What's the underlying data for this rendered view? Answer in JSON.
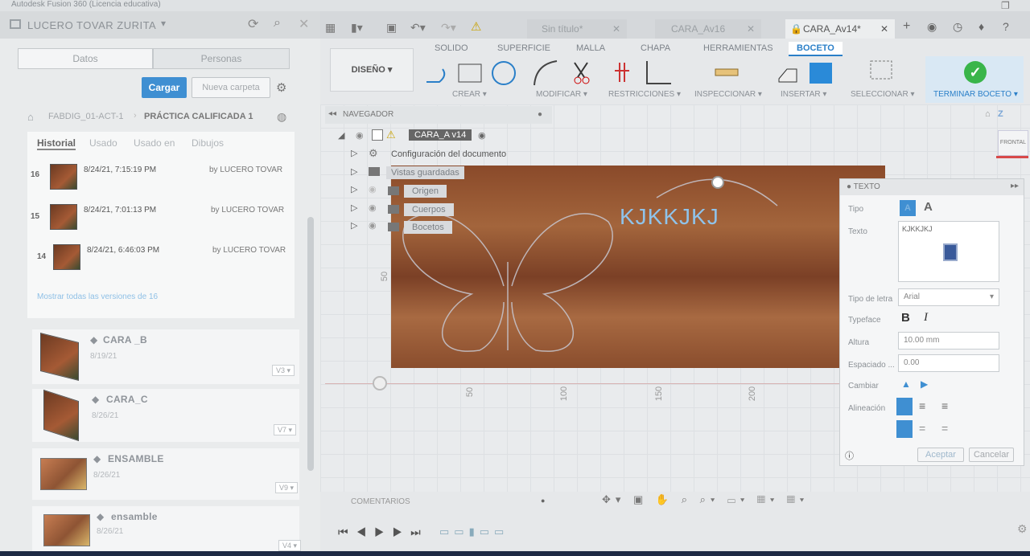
{
  "window_title": "Autodesk Fusion 360 (Licencia educativa)",
  "user_name": "LUCERO TOVAR ZURITA",
  "data_tabs": [
    "Datos",
    "Personas"
  ],
  "upload_label": "Cargar",
  "new_folder_label": "Nueva carpeta",
  "breadcrumb": {
    "folder": "FABDIG_01-ACT-1",
    "current": "PRÁCTICA CALIFICADA 1"
  },
  "history_tabs": [
    "Historial",
    "Usado",
    "Usado en",
    "Dibujos"
  ],
  "history": [
    {
      "version": "16",
      "date": "8/24/21, 7:15:19 PM",
      "by": "by LUCERO TOVAR"
    },
    {
      "version": "15",
      "date": "8/24/21, 7:01:13 PM",
      "by": "by LUCERO TOVAR"
    },
    {
      "version": "14",
      "date": "8/24/21, 6:46:03 PM",
      "by": "by LUCERO TOVAR"
    }
  ],
  "show_all_versions": "Mostrar todas las versiones de 16",
  "files": [
    {
      "name": "CARA _B",
      "date": "8/19/21",
      "version": "V3 ▾"
    },
    {
      "name": "CARA_C",
      "date": "8/26/21",
      "version": "V7 ▾"
    },
    {
      "name": "ENSAMBLE",
      "date": "8/26/21",
      "version": "V9 ▾"
    },
    {
      "name": "ensamble",
      "date": "8/26/21",
      "version": "V4 ▾"
    }
  ],
  "doc_tabs": [
    "Sin título*",
    "CARA_Av16",
    "CARA_Av14*"
  ],
  "toolbar_tabs": [
    "SOLIDO",
    "SUPERFICIE",
    "MALLA",
    "CHAPA",
    "HERRAMIENTAS",
    "BOCETO"
  ],
  "design_label": "DISEÑO ▾",
  "groups": [
    "CREAR ▾",
    "MODIFICAR ▾",
    "RESTRICCIONES ▾",
    "INSPECCIONAR ▾",
    "INSERTAR ▾",
    "SELECCIONAR ▾",
    "TERMINAR BOCETO ▾"
  ],
  "navigator": {
    "title": "NAVEGADOR",
    "root": "CARA_A v14",
    "items": [
      "Configuración del documento",
      "Vistas guardadas",
      "Origen",
      "Cuerpos",
      "Bocetos"
    ]
  },
  "sketch_text": "KJKKJKJ",
  "axis_labels": {
    "y50": "50",
    "x50": "50",
    "x100": "100",
    "x150": "150",
    "x200": "200"
  },
  "viewcube": {
    "label": "FRONTAL",
    "axis": "Z"
  },
  "text_panel": {
    "title": "TEXTO",
    "tipo_label": "Tipo",
    "texto_label": "Texto",
    "texto_value": "KJKKJKJ",
    "font_label": "Tipo de letra",
    "font_value": "Arial",
    "typeface_label": "Typeface",
    "height_label": "Altura",
    "height_value": "10.00 mm",
    "spacing_label": "Espaciado ...",
    "spacing_value": "0.00",
    "flip_label": "Cambiar",
    "align_label": "Alineación",
    "ok": "Aceptar",
    "cancel": "Cancelar"
  },
  "comments_label": "COMENTARIOS",
  "accent": "#3f8fd2"
}
